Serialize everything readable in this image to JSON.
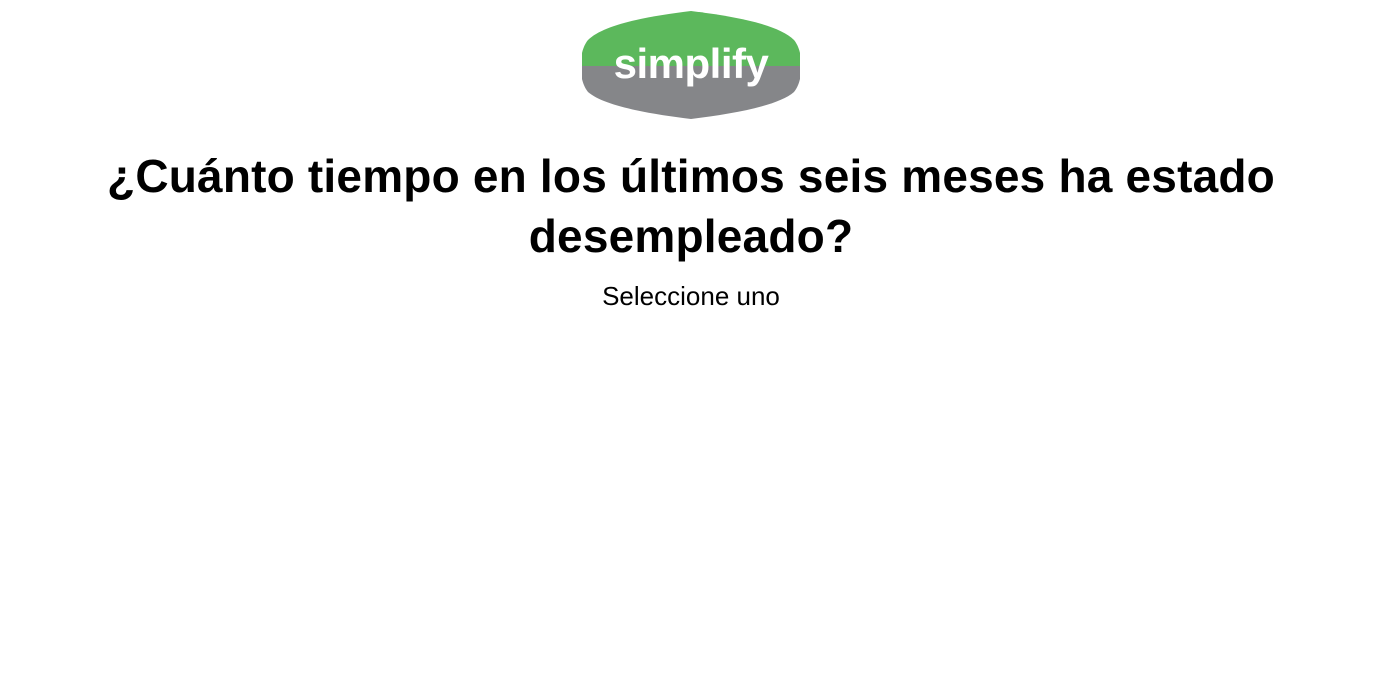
{
  "brand": {
    "logo_text": "simplify",
    "logo_top_color": "#5cb85c",
    "logo_bottom_color": "#858689",
    "logo_text_color": "#ffffff"
  },
  "question": {
    "title": "¿Cuánto tiempo en los últimos seis meses ha estado desempleado?",
    "instruction": "Seleccione uno"
  },
  "options": []
}
